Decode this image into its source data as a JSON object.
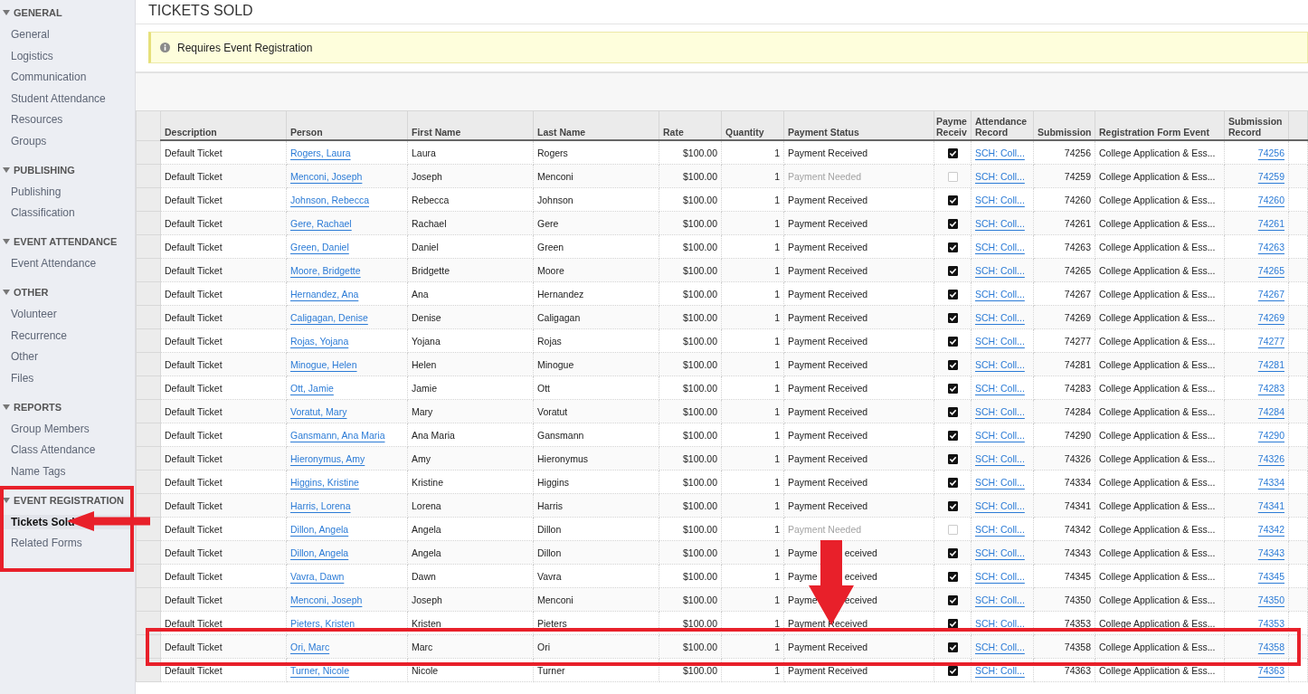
{
  "sidebar": {
    "sections": [
      {
        "title": "GENERAL",
        "items": [
          {
            "label": "General",
            "selected": false
          },
          {
            "label": "Logistics",
            "selected": false
          },
          {
            "label": "Communication",
            "selected": false
          },
          {
            "label": "Student Attendance",
            "selected": false
          },
          {
            "label": "Resources",
            "selected": false
          },
          {
            "label": "Groups",
            "selected": false
          }
        ]
      },
      {
        "title": "PUBLISHING",
        "items": [
          {
            "label": "Publishing",
            "selected": false
          },
          {
            "label": "Classification",
            "selected": false
          }
        ]
      },
      {
        "title": "EVENT ATTENDANCE",
        "items": [
          {
            "label": "Event Attendance",
            "selected": false
          }
        ]
      },
      {
        "title": "OTHER",
        "items": [
          {
            "label": "Volunteer",
            "selected": false
          },
          {
            "label": "Recurrence",
            "selected": false
          },
          {
            "label": "Other",
            "selected": false
          },
          {
            "label": "Files",
            "selected": false
          }
        ]
      },
      {
        "title": "REPORTS",
        "items": [
          {
            "label": "Group Members",
            "selected": false
          },
          {
            "label": "Class Attendance",
            "selected": false
          },
          {
            "label": "Name Tags",
            "selected": false
          }
        ]
      },
      {
        "title": "EVENT REGISTRATION",
        "items": [
          {
            "label": "Tickets Sold",
            "selected": true
          },
          {
            "label": "Related Forms",
            "selected": false
          }
        ]
      }
    ]
  },
  "page_title": "TICKETS SOLD",
  "notice": "Requires Event Registration",
  "table": {
    "columns": [
      "Description",
      "Person",
      "First Name",
      "Last Name",
      "Rate",
      "Quantity",
      "Payment Status",
      "Payme Receiv",
      "Attendance Record",
      "Submission",
      "Registration Form Event",
      "Submission Record"
    ],
    "rows": [
      {
        "description": "Default Ticket",
        "person": "Rogers, Laura",
        "first_name": "Laura",
        "last_name": "Rogers",
        "rate": "$100.00",
        "quantity": "1",
        "payment_status": "Payment Received",
        "payment_received": true,
        "attendance_record": "SCH: Coll...",
        "submission": "74256",
        "registration_form_event": "College Application & Ess...",
        "submission_record": "74256"
      },
      {
        "description": "Default Ticket",
        "person": "Menconi, Joseph",
        "first_name": "Joseph",
        "last_name": "Menconi",
        "rate": "$100.00",
        "quantity": "1",
        "payment_status": "Payment Needed",
        "payment_received": false,
        "attendance_record": "SCH: Coll...",
        "submission": "74259",
        "registration_form_event": "College Application & Ess...",
        "submission_record": "74259"
      },
      {
        "description": "Default Ticket",
        "person": "Johnson, Rebecca",
        "first_name": "Rebecca",
        "last_name": "Johnson",
        "rate": "$100.00",
        "quantity": "1",
        "payment_status": "Payment Received",
        "payment_received": true,
        "attendance_record": "SCH: Coll...",
        "submission": "74260",
        "registration_form_event": "College Application & Ess...",
        "submission_record": "74260"
      },
      {
        "description": "Default Ticket",
        "person": "Gere, Rachael",
        "first_name": "Rachael",
        "last_name": "Gere",
        "rate": "$100.00",
        "quantity": "1",
        "payment_status": "Payment Received",
        "payment_received": true,
        "attendance_record": "SCH: Coll...",
        "submission": "74261",
        "registration_form_event": "College Application & Ess...",
        "submission_record": "74261"
      },
      {
        "description": "Default Ticket",
        "person": "Green, Daniel",
        "first_name": "Daniel",
        "last_name": "Green",
        "rate": "$100.00",
        "quantity": "1",
        "payment_status": "Payment Received",
        "payment_received": true,
        "attendance_record": "SCH: Coll...",
        "submission": "74263",
        "registration_form_event": "College Application & Ess...",
        "submission_record": "74263"
      },
      {
        "description": "Default Ticket",
        "person": "Moore, Bridgette",
        "first_name": "Bridgette",
        "last_name": "Moore",
        "rate": "$100.00",
        "quantity": "1",
        "payment_status": "Payment Received",
        "payment_received": true,
        "attendance_record": "SCH: Coll...",
        "submission": "74265",
        "registration_form_event": "College Application & Ess...",
        "submission_record": "74265"
      },
      {
        "description": "Default Ticket",
        "person": "Hernandez, Ana",
        "first_name": "Ana",
        "last_name": "Hernandez",
        "rate": "$100.00",
        "quantity": "1",
        "payment_status": "Payment Received",
        "payment_received": true,
        "attendance_record": "SCH: Coll...",
        "submission": "74267",
        "registration_form_event": "College Application & Ess...",
        "submission_record": "74267"
      },
      {
        "description": "Default Ticket",
        "person": "Caligagan, Denise",
        "first_name": "Denise",
        "last_name": "Caligagan",
        "rate": "$100.00",
        "quantity": "1",
        "payment_status": "Payment Received",
        "payment_received": true,
        "attendance_record": "SCH: Coll...",
        "submission": "74269",
        "registration_form_event": "College Application & Ess...",
        "submission_record": "74269"
      },
      {
        "description": "Default Ticket",
        "person": "Rojas, Yojana",
        "first_name": "Yojana",
        "last_name": "Rojas",
        "rate": "$100.00",
        "quantity": "1",
        "payment_status": "Payment Received",
        "payment_received": true,
        "attendance_record": "SCH: Coll...",
        "submission": "74277",
        "registration_form_event": "College Application & Ess...",
        "submission_record": "74277"
      },
      {
        "description": "Default Ticket",
        "person": "Minogue, Helen",
        "first_name": "Helen",
        "last_name": "Minogue",
        "rate": "$100.00",
        "quantity": "1",
        "payment_status": "Payment Received",
        "payment_received": true,
        "attendance_record": "SCH: Coll...",
        "submission": "74281",
        "registration_form_event": "College Application & Ess...",
        "submission_record": "74281"
      },
      {
        "description": "Default Ticket",
        "person": "Ott, Jamie",
        "first_name": "Jamie",
        "last_name": "Ott",
        "rate": "$100.00",
        "quantity": "1",
        "payment_status": "Payment Received",
        "payment_received": true,
        "attendance_record": "SCH: Coll...",
        "submission": "74283",
        "registration_form_event": "College Application & Ess...",
        "submission_record": "74283"
      },
      {
        "description": "Default Ticket",
        "person": "Voratut, Mary",
        "first_name": "Mary",
        "last_name": "Voratut",
        "rate": "$100.00",
        "quantity": "1",
        "payment_status": "Payment Received",
        "payment_received": true,
        "attendance_record": "SCH: Coll...",
        "submission": "74284",
        "registration_form_event": "College Application & Ess...",
        "submission_record": "74284"
      },
      {
        "description": "Default Ticket",
        "person": "Gansmann, Ana Maria",
        "first_name": "Ana Maria",
        "last_name": "Gansmann",
        "rate": "$100.00",
        "quantity": "1",
        "payment_status": "Payment Received",
        "payment_received": true,
        "attendance_record": "SCH: Coll...",
        "submission": "74290",
        "registration_form_event": "College Application & Ess...",
        "submission_record": "74290"
      },
      {
        "description": "Default Ticket",
        "person": "Hieronymus, Amy",
        "first_name": "Amy",
        "last_name": "Hieronymus",
        "rate": "$100.00",
        "quantity": "1",
        "payment_status": "Payment Received",
        "payment_received": true,
        "attendance_record": "SCH: Coll...",
        "submission": "74326",
        "registration_form_event": "College Application & Ess...",
        "submission_record": "74326"
      },
      {
        "description": "Default Ticket",
        "person": "Higgins, Kristine",
        "first_name": "Kristine",
        "last_name": "Higgins",
        "rate": "$100.00",
        "quantity": "1",
        "payment_status": "Payment Received",
        "payment_received": true,
        "attendance_record": "SCH: Coll...",
        "submission": "74334",
        "registration_form_event": "College Application & Ess...",
        "submission_record": "74334"
      },
      {
        "description": "Default Ticket",
        "person": "Harris, Lorena",
        "first_name": "Lorena",
        "last_name": "Harris",
        "rate": "$100.00",
        "quantity": "1",
        "payment_status": "Payment Received",
        "payment_received": true,
        "attendance_record": "SCH: Coll...",
        "submission": "74341",
        "registration_form_event": "College Application & Ess...",
        "submission_record": "74341"
      },
      {
        "description": "Default Ticket",
        "person": "Dillon, Angela",
        "first_name": "Angela",
        "last_name": "Dillon",
        "rate": "$100.00",
        "quantity": "1",
        "payment_status": "Payment Needed",
        "payment_received": false,
        "attendance_record": "SCH: Coll...",
        "submission": "74342",
        "registration_form_event": "College Application & Ess...",
        "submission_record": "74342"
      },
      {
        "description": "Default Ticket",
        "person": "Dillon, Angela",
        "first_name": "Angela",
        "last_name": "Dillon",
        "rate": "$100.00",
        "quantity": "1",
        "payment_status": "Payme",
        "payment_status_2": "eceived",
        "payment_received": true,
        "attendance_record": "SCH: Coll...",
        "submission": "74343",
        "registration_form_event": "College Application & Ess...",
        "submission_record": "74343"
      },
      {
        "description": "Default Ticket",
        "person": "Vavra, Dawn",
        "first_name": "Dawn",
        "last_name": "Vavra",
        "rate": "$100.00",
        "quantity": "1",
        "payment_status": "Payme",
        "payment_status_2": "eceived",
        "payment_received": true,
        "attendance_record": "SCH: Coll...",
        "submission": "74345",
        "registration_form_event": "College Application & Ess...",
        "submission_record": "74345"
      },
      {
        "description": "Default Ticket",
        "person": "Menconi, Joseph",
        "first_name": "Joseph",
        "last_name": "Menconi",
        "rate": "$100.00",
        "quantity": "1",
        "payment_status": "Payme",
        "payment_status_2": "eceived",
        "payment_received": true,
        "attendance_record": "SCH: Coll...",
        "submission": "74350",
        "registration_form_event": "College Application & Ess...",
        "submission_record": "74350"
      },
      {
        "description": "Default Ticket",
        "person": "Pieters, Kristen",
        "first_name": "Kristen",
        "last_name": "Pieters",
        "rate": "$100.00",
        "quantity": "1",
        "payment_status": "Payment Received",
        "payment_received": true,
        "attendance_record": "SCH: Coll...",
        "submission": "74353",
        "registration_form_event": "College Application & Ess...",
        "submission_record": "74353"
      },
      {
        "description": "Default Ticket",
        "person": "Ori, Marc",
        "first_name": "Marc",
        "last_name": "Ori",
        "rate": "$100.00",
        "quantity": "1",
        "payment_status": "Payment Received",
        "payment_received": true,
        "attendance_record": "SCH: Coll...",
        "submission": "74358",
        "registration_form_event": "College Application & Ess...",
        "submission_record": "74358"
      },
      {
        "description": "Default Ticket",
        "person": "Turner, Nicole",
        "first_name": "Nicole",
        "last_name": "Turner",
        "rate": "$100.00",
        "quantity": "1",
        "payment_status": "Payment Received",
        "payment_received": true,
        "attendance_record": "SCH: Coll...",
        "submission": "74363",
        "registration_form_event": "College Application & Ess...",
        "submission_record": "74363"
      }
    ]
  }
}
